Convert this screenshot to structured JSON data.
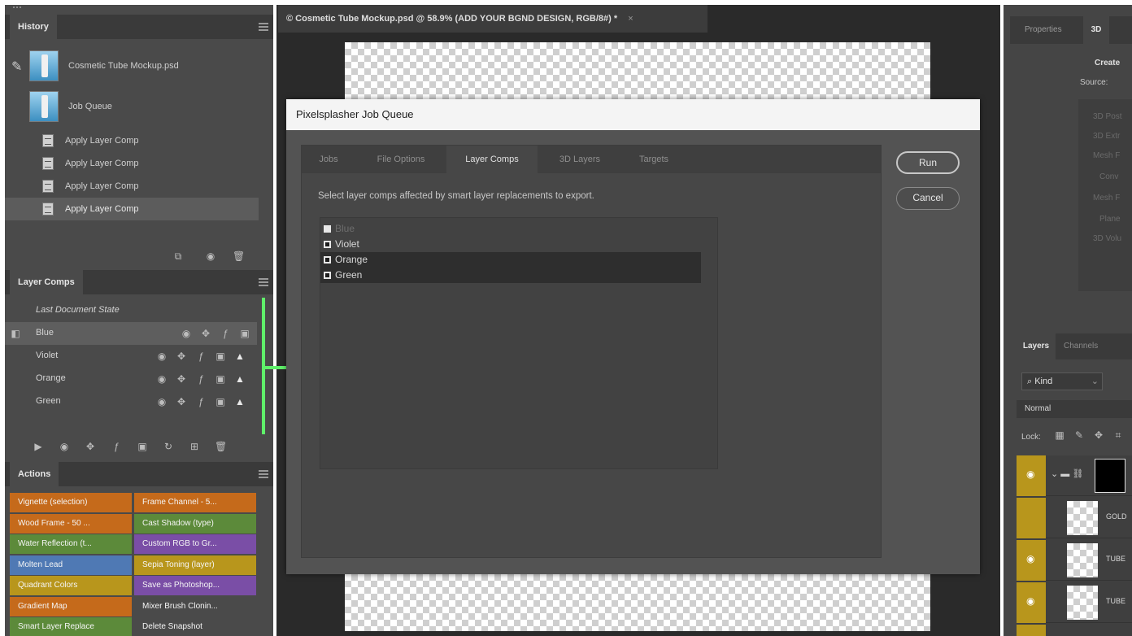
{
  "document_tab": {
    "title": "© Cosmetic Tube Mockup.psd @ 58.9% (ADD YOUR BGND DESIGN, RGB/8#) *",
    "close": "×"
  },
  "history": {
    "tab": "History",
    "items": [
      {
        "label": "Cosmetic Tube Mockup.psd",
        "kind": "snapshot"
      },
      {
        "label": "Job Queue",
        "kind": "snapshot"
      },
      {
        "label": "Apply Layer Comp",
        "kind": "step"
      },
      {
        "label": "Apply Layer Comp",
        "kind": "step"
      },
      {
        "label": "Apply Layer Comp",
        "kind": "step"
      },
      {
        "label": "Apply Layer Comp",
        "kind": "step"
      }
    ]
  },
  "layer_comps": {
    "tab": "Layer Comps",
    "last_state": "Last Document State",
    "items": [
      {
        "label": "Blue"
      },
      {
        "label": "Violet"
      },
      {
        "label": "Orange"
      },
      {
        "label": "Green"
      }
    ]
  },
  "actions": {
    "tab": "Actions",
    "buttons": [
      {
        "label": "Vignette (selection)",
        "color": "#c56a1b"
      },
      {
        "label": "Frame Channel - 5...",
        "color": "#c56a1b"
      },
      {
        "label": "Wood Frame - 50 ...",
        "color": "#c56a1b"
      },
      {
        "label": "Cast Shadow (type)",
        "color": "#5c8a3a"
      },
      {
        "label": "Water Reflection (t...",
        "color": "#5c8a3a"
      },
      {
        "label": "Custom RGB to Gr...",
        "color": "#7a4ea6"
      },
      {
        "label": "Molten Lead",
        "color": "#4f79b4"
      },
      {
        "label": "Sepia Toning (layer)",
        "color": "#b8961c"
      },
      {
        "label": "Quadrant Colors",
        "color": "#b8961c"
      },
      {
        "label": "Save as Photoshop...",
        "color": "#7a4ea6"
      },
      {
        "label": "Gradient Map",
        "color": "#c56a1b"
      },
      {
        "label": "Mixer Brush Clonin...",
        "color": "#4a4a4a"
      },
      {
        "label": "Smart Layer Replace",
        "color": "#5c8a3a"
      },
      {
        "label": "Delete Snapshot",
        "color": "#4a4a4a"
      }
    ]
  },
  "dialog": {
    "title": "Pixelsplasher Job Queue",
    "tabs": [
      "Jobs",
      "File Options",
      "Layer Comps",
      "3D Layers",
      "Targets"
    ],
    "active_tab": "Layer Comps",
    "description": "Select layer comps affected by smart layer replacements to export.",
    "list": [
      {
        "label": "Blue",
        "state": "disabled"
      },
      {
        "label": "Violet",
        "state": "normal"
      },
      {
        "label": "Orange",
        "state": "selected"
      },
      {
        "label": "Green",
        "state": "selected"
      }
    ],
    "run_label": "Run",
    "cancel_label": "Cancel"
  },
  "properties": {
    "tabs": [
      "Properties",
      "3D"
    ],
    "create_label": "Create",
    "source_label": "Source:",
    "options": [
      "3D Post",
      "3D Extr",
      "Mesh F",
      "Conv",
      "Mesh F",
      "Plane",
      "3D Volu"
    ]
  },
  "layers": {
    "tabs": [
      "Layers",
      "Channels"
    ],
    "kind_label": "Kind",
    "blend_mode": "Normal",
    "lock_label": "Lock:",
    "rows": [
      {
        "label": ""
      },
      {
        "label": "GOLD"
      },
      {
        "label": "TUBE"
      },
      {
        "label": "TUBE"
      }
    ]
  },
  "colors": {
    "accent_green": "#5ff06a",
    "dialog_bg": "#535353",
    "panel_bg": "#4a4a4a"
  }
}
